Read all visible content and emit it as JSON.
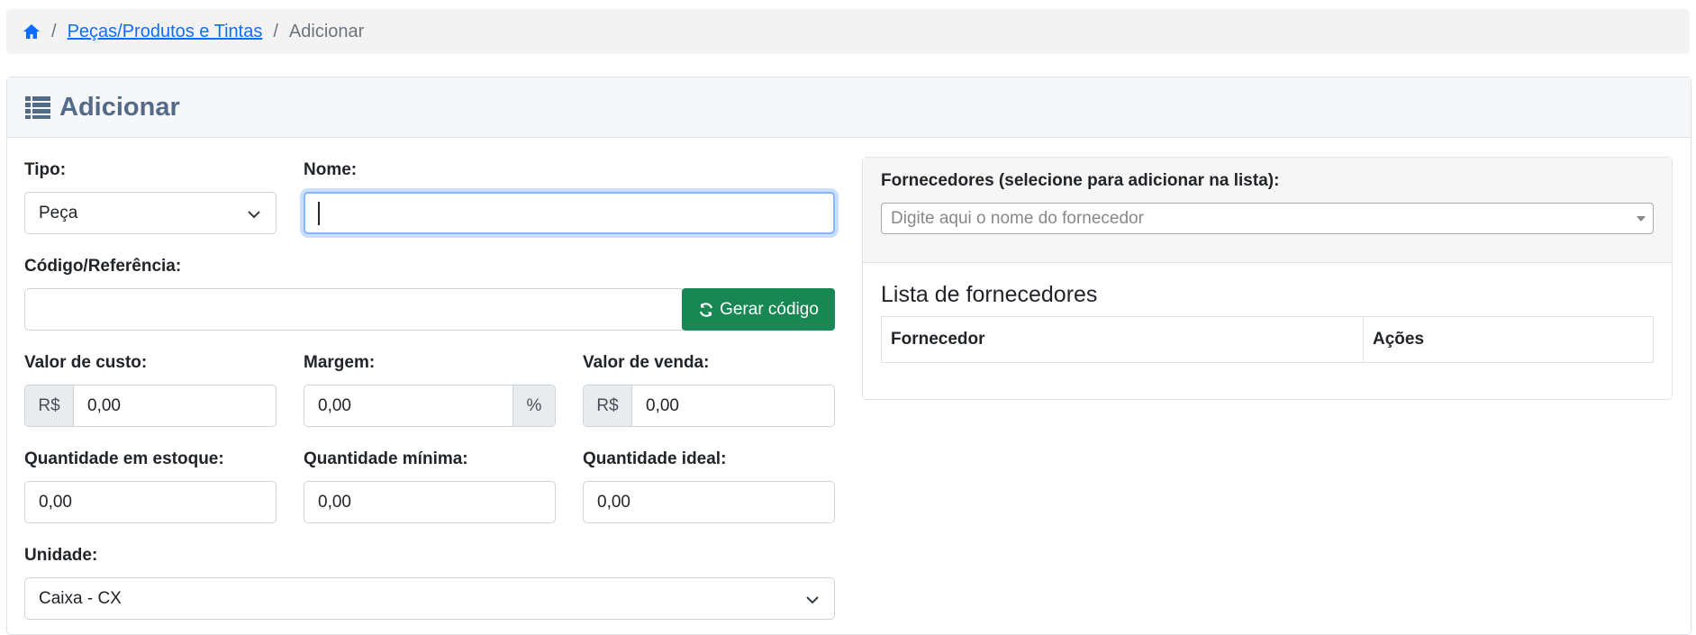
{
  "breadcrumb": {
    "home_icon": "home-icon",
    "separator": "/",
    "link": "Peças/Produtos e Tintas",
    "current": "Adicionar"
  },
  "card": {
    "title_icon": "list-icon",
    "title": "Adicionar"
  },
  "form": {
    "tipo": {
      "label": "Tipo:",
      "value": "Peça"
    },
    "nome": {
      "label": "Nome:",
      "value": ""
    },
    "codigo": {
      "label": "Código/Referência:",
      "value": "",
      "button_label": "Gerar código",
      "button_icon": "refresh-icon"
    },
    "valor_custo": {
      "label": "Valor de custo:",
      "prefix": "R$",
      "value": "0,00"
    },
    "margem": {
      "label": "Margem:",
      "suffix": "%",
      "value": "0,00"
    },
    "valor_venda": {
      "label": "Valor de venda:",
      "prefix": "R$",
      "value": "0,00"
    },
    "qtd_estoque": {
      "label": "Quantidade em estoque:",
      "value": "0,00"
    },
    "qtd_minima": {
      "label": "Quantidade mínima:",
      "value": "0,00"
    },
    "qtd_ideal": {
      "label": "Quantidade ideal:",
      "value": "0,00"
    },
    "unidade": {
      "label": "Unidade:",
      "value": "Caixa - CX"
    }
  },
  "fornecedores": {
    "title": "Fornecedores (selecione para adicionar na lista):",
    "placeholder": "Digite aqui o nome do fornecedor",
    "lista_title": "Lista de fornecedores",
    "columns": [
      "Fornecedor",
      "Ações"
    ]
  },
  "colors": {
    "link": "#0d6efd",
    "header_text": "#536b88",
    "success": "#198754",
    "focus": "#86b7fe"
  }
}
